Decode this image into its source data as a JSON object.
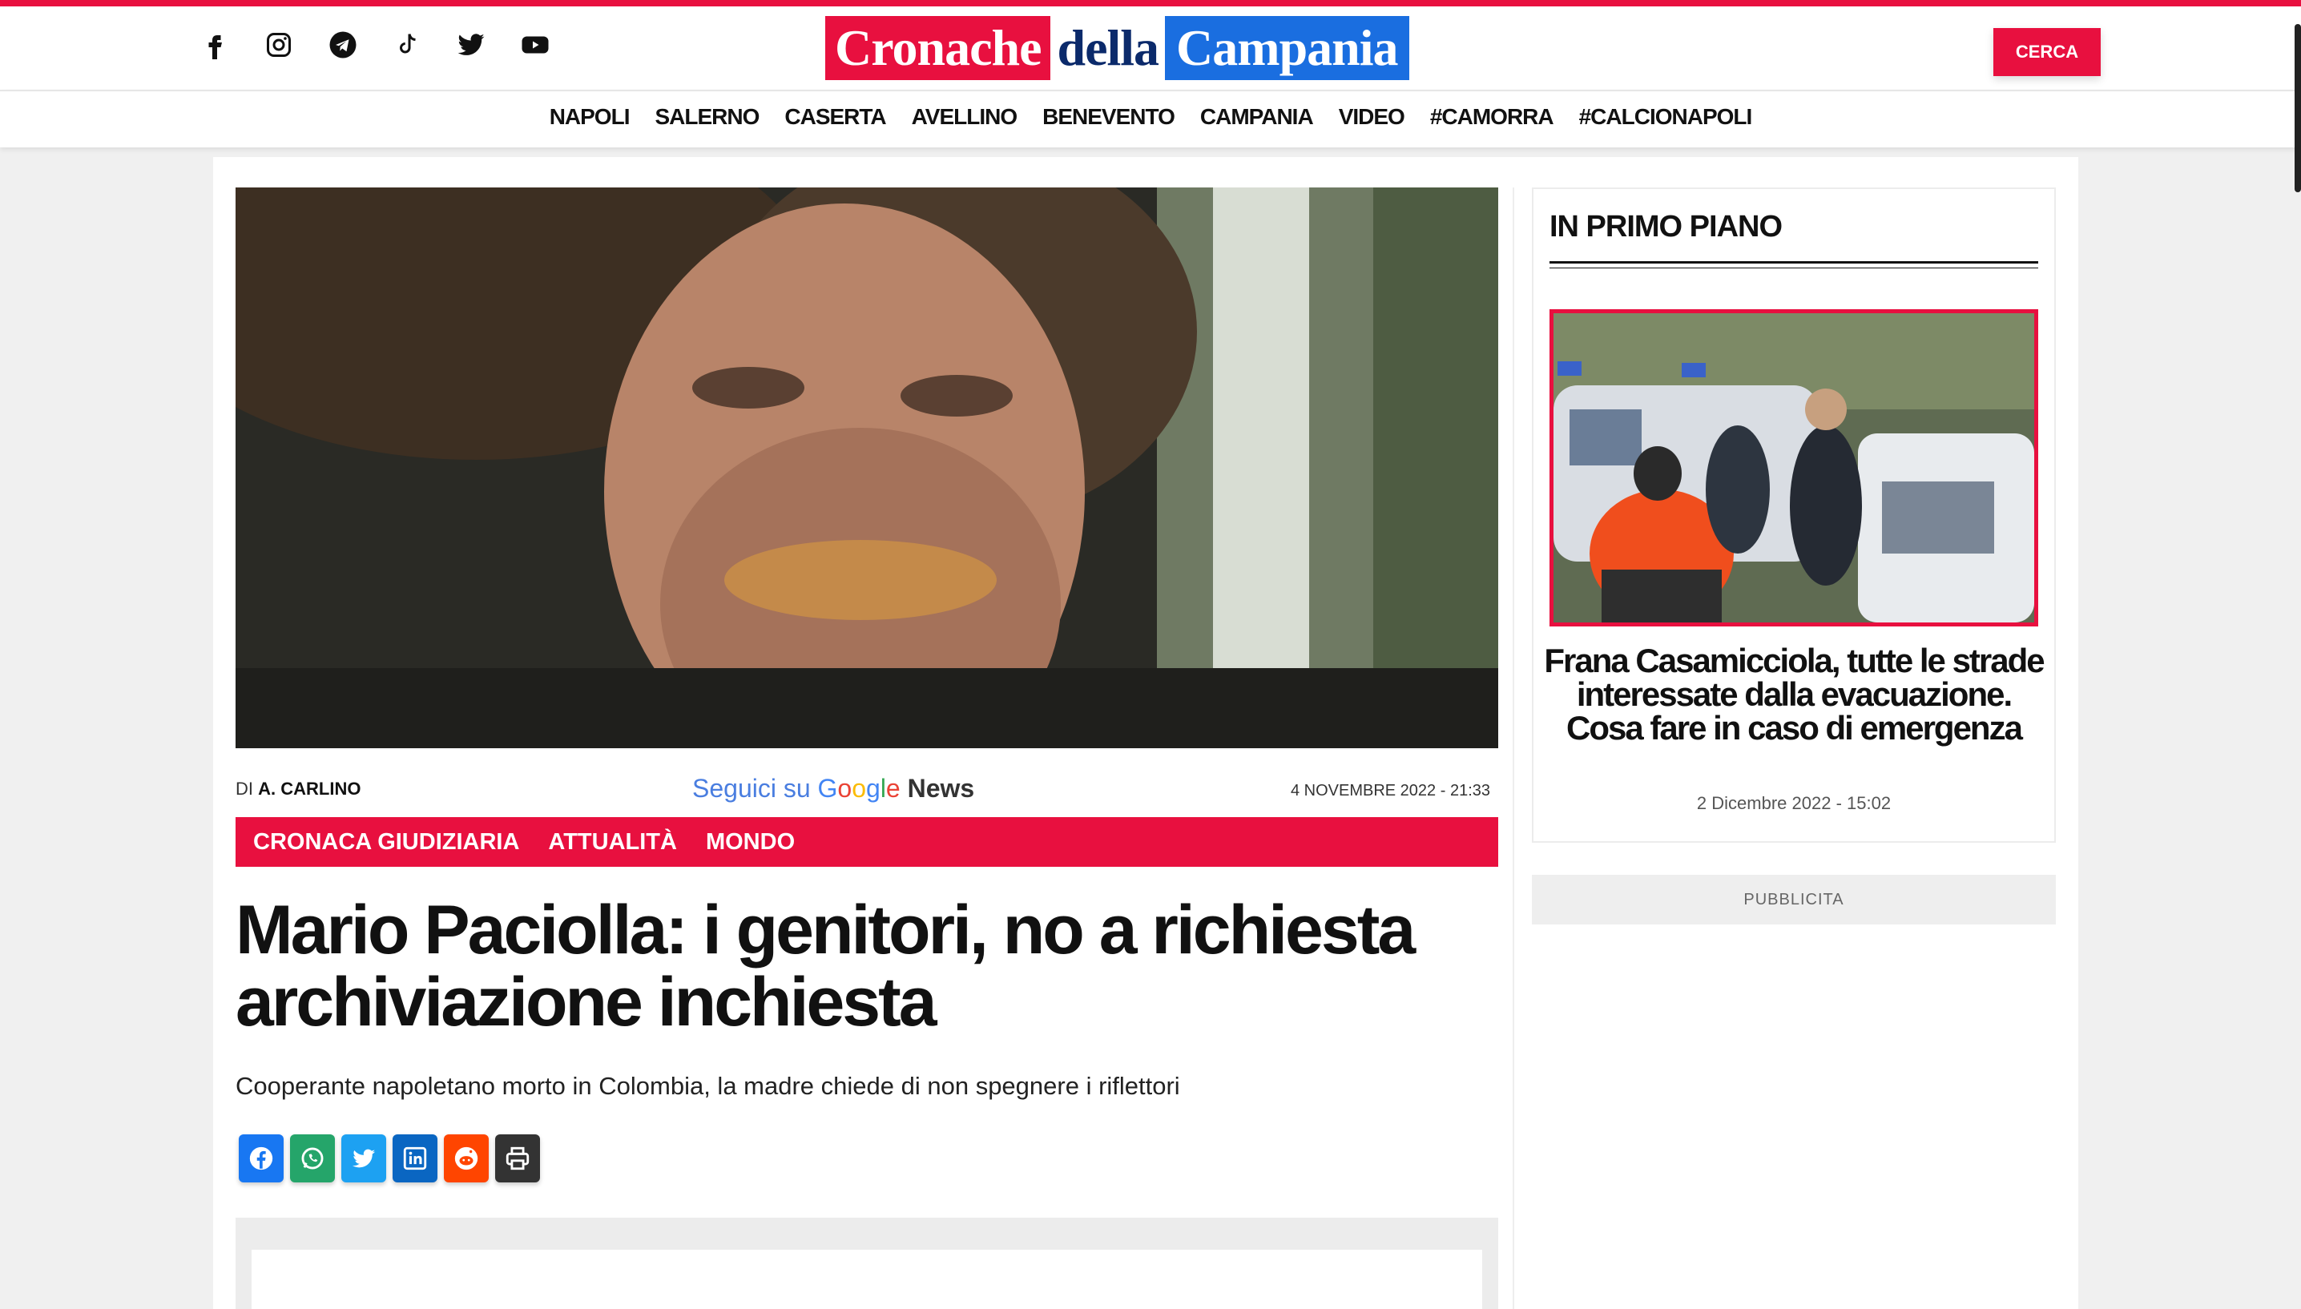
{
  "header": {
    "social": [
      "facebook-icon",
      "instagram-icon",
      "telegram-icon",
      "tiktok-icon",
      "twitter-icon",
      "youtube-icon"
    ],
    "logo": {
      "part1": "Cronache",
      "part2": "della",
      "part3": "Campania"
    },
    "search_label": "CERCA"
  },
  "nav": [
    "NAPOLI",
    "SALERNO",
    "CASERTA",
    "AVELLINO",
    "BENEVENTO",
    "CAMPANIA",
    "VIDEO",
    "#CAMORRA",
    "#CALCIONAPOLI"
  ],
  "article": {
    "author_prefix": "DI",
    "author": "A. CARLINO",
    "google_news": {
      "prefix": "Seguici su",
      "brand": "Google",
      "suffix": "News"
    },
    "date": "4 NOVEMBRE 2022 - 21:33",
    "categories": [
      "CRONACA GIUDIZIARIA",
      "ATTUALITÀ",
      "MONDO"
    ],
    "title": "Mario Paciolla: i genitori, no a richiesta archiviazione inchiesta",
    "subtitle": "Cooperante napoletano morto in Colombia, la madre chiede di non spegnere i riflettori",
    "share": [
      {
        "icon": "facebook-icon",
        "color": "#1877f2"
      },
      {
        "icon": "whatsapp-icon",
        "color": "#25a56a"
      },
      {
        "icon": "twitter-icon",
        "color": "#1da1f2"
      },
      {
        "icon": "linkedin-icon",
        "color": "#0a66c2"
      },
      {
        "icon": "reddit-icon",
        "color": "#ff4500"
      },
      {
        "icon": "print-icon",
        "color": "#333333"
      }
    ]
  },
  "sidebar": {
    "title": "IN PRIMO PIANO",
    "headline": "Frana Casamicciola, tutte le strade interessate dalla evacuazione. Cosa fare in caso di emergenza",
    "date": "2 Dicembre 2022 - 15:02",
    "ad_label": "PUBBLICITA"
  },
  "colors": {
    "accent": "#e8103f",
    "logo_blue": "#1a6ee0"
  }
}
